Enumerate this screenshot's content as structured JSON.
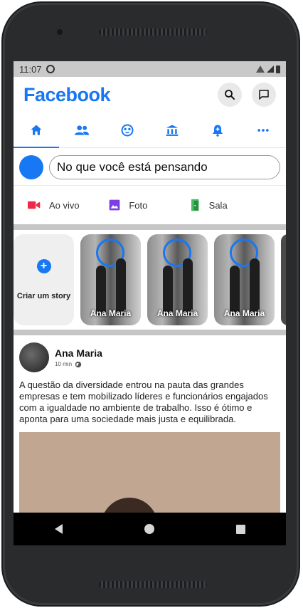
{
  "status_bar": {
    "time": "11:07"
  },
  "app": {
    "brand": "Facebook"
  },
  "tabs": [
    {
      "icon": "home-icon"
    },
    {
      "icon": "friends-icon"
    },
    {
      "icon": "groups-icon"
    },
    {
      "icon": "marketplace-icon"
    },
    {
      "icon": "notifications-icon"
    },
    {
      "icon": "more-icon"
    }
  ],
  "composer": {
    "placeholder": "No que você está pensando"
  },
  "quick_actions": [
    {
      "label": "Ao vivo",
      "icon": "video-icon",
      "color": "#f02849"
    },
    {
      "label": "Foto",
      "icon": "photo-icon",
      "color": "#7b3fe4"
    },
    {
      "label": "Sala",
      "icon": "room-icon",
      "color": "#45bd62"
    }
  ],
  "stories": {
    "create_label": "Criar um story",
    "items": [
      {
        "name": "Ana Maria"
      },
      {
        "name": "Ana Maria"
      },
      {
        "name": "Ana Maria"
      }
    ]
  },
  "post": {
    "author": "Ana Maria",
    "time": "10 min",
    "text": "A questão da diversidade entrou na pauta das grandes empresas e tem mobilizado líderes e funcionários engajados com a igualdade no ambiente de trabalho. Isso é ótimo e aponta para uma sociedade mais justa e equilibrada."
  },
  "colors": {
    "brand": "#1877f2"
  }
}
